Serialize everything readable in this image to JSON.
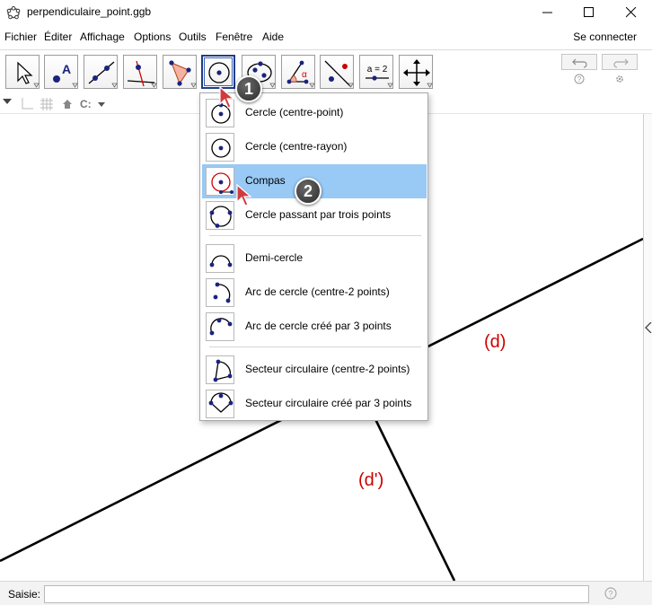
{
  "window": {
    "title": "perpendiculaire_point.ggb"
  },
  "menu": {
    "items": [
      "Fichier",
      "Éditer",
      "Affichage",
      "Options",
      "Outils",
      "Fenêtre",
      "Aide"
    ],
    "signin": "Se connecter"
  },
  "toolbar": {
    "tools": [
      {
        "name": "move-tool",
        "icon": "arrow-cursor-icon"
      },
      {
        "name": "point-tool",
        "icon": "point-a-icon"
      },
      {
        "name": "line-tool",
        "icon": "line-two-points-icon"
      },
      {
        "name": "perpendicular-tool",
        "icon": "perpendicular-line-icon"
      },
      {
        "name": "polygon-tool",
        "icon": "polygon-icon"
      },
      {
        "name": "circle-tool",
        "icon": "circle-center-point-icon",
        "selected": true
      },
      {
        "name": "conic-tool",
        "icon": "ellipse-icon"
      },
      {
        "name": "angle-tool",
        "icon": "angle-alpha-icon"
      },
      {
        "name": "reflect-tool",
        "icon": "reflect-line-icon"
      },
      {
        "name": "slider-tool",
        "icon": "slider-icon",
        "label": "a = 2"
      },
      {
        "name": "move-graphics-tool",
        "icon": "move-cross-icon"
      }
    ]
  },
  "dropdown": {
    "items": [
      {
        "label": "Cercle (centre-point)",
        "icon": "circle-center-point-icon"
      },
      {
        "label": "Cercle (centre-rayon)",
        "icon": "circle-center-radius-icon"
      },
      {
        "label": "Compas",
        "icon": "compass-icon",
        "highlighted": true
      },
      {
        "label": "Cercle passant par trois points",
        "icon": "circle-three-points-icon"
      },
      {
        "label": "Demi-cercle",
        "icon": "semicircle-icon"
      },
      {
        "label": "Arc de cercle (centre-2 points)",
        "icon": "arc-center-two-points-icon"
      },
      {
        "label": "Arc de cercle créé par 3 points",
        "icon": "arc-three-points-icon"
      },
      {
        "label": "Secteur circulaire (centre-2 points)",
        "icon": "sector-center-two-points-icon"
      },
      {
        "label": "Secteur circulaire créé par 3 points",
        "icon": "sector-three-points-icon"
      }
    ]
  },
  "graphics": {
    "line_d_label": "(d)",
    "line_d_prime_label": "(d')",
    "line_color": "#000000",
    "label_color": "#cc0000"
  },
  "annotations": {
    "badge_1": "1",
    "badge_2": "2"
  },
  "input": {
    "label": "Saisie:",
    "value": ""
  },
  "colors": {
    "highlight": "#99c9f5",
    "selected_border": "#1f3c88",
    "point_blue": "#1a237e"
  }
}
